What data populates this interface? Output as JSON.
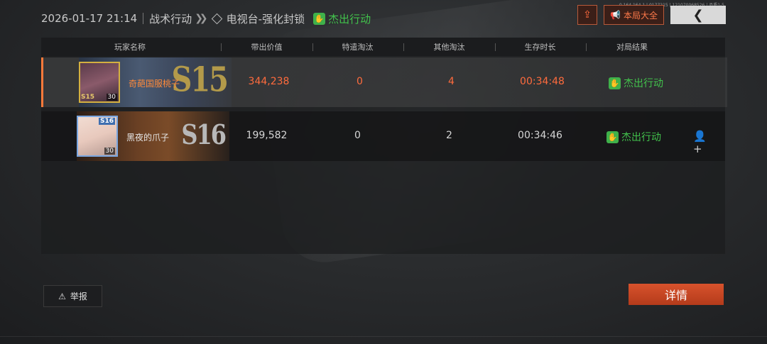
{
  "header": {
    "datetime": "2026-01-17 21:14",
    "mode": "战术行动",
    "chevrons": "❯❯",
    "map": "电视台-强化封锁",
    "status": "杰出行动"
  },
  "top_right": {
    "share_icon": "share-icon",
    "summary_label": "本局大全",
    "back_icon": "❮",
    "tiny_id": "0.164.164.1 | 0177215 | 121070068526 | 品质1-5"
  },
  "table": {
    "columns": [
      "玩家名称",
      "带出价值",
      "特遣淘汰",
      "其他淘汰",
      "生存时长",
      "对局结果"
    ],
    "rows": [
      {
        "name": "奇葩国服桃子",
        "value": "344,238",
        "special_kills": "0",
        "other_kills": "4",
        "survival": "00:34:48",
        "result": "杰出行动",
        "tier": "S15",
        "level": "30",
        "rank_tag": "S15",
        "highlight": true
      },
      {
        "name": "黑夜的爪子",
        "value": "199,582",
        "special_kills": "0",
        "other_kills": "2",
        "survival": "00:34:46",
        "result": "杰出行动",
        "tier": "S16",
        "level": "30",
        "rank_tag": "S16",
        "highlight": false
      }
    ]
  },
  "footer": {
    "report_label": "举报",
    "detail_label": "详情"
  },
  "colors": {
    "accent": "#ff6b3d",
    "success": "#42c24c"
  }
}
